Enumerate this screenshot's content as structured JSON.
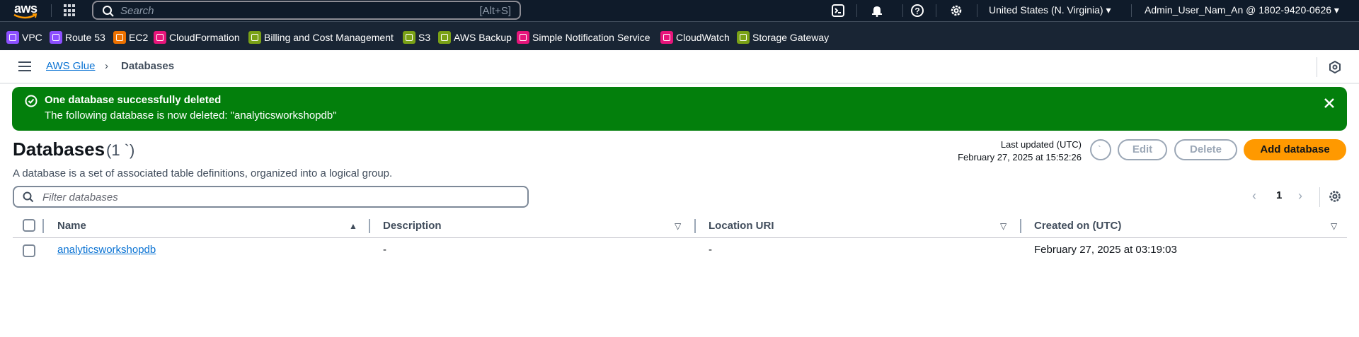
{
  "topnav": {
    "logo_text": "aws",
    "search_placeholder": "Search",
    "search_shortcut": "[Alt+S]",
    "region": "United States (N. Virginia)",
    "account": "Admin_User_Nam_An @ 1802-9420-0626"
  },
  "favorites": [
    {
      "label": "VPC",
      "color": "#8c4fff",
      "icon": "vpc-icon"
    },
    {
      "label": "Route 53",
      "color": "#8c4fff",
      "icon": "route53-icon"
    },
    {
      "label": "EC2",
      "color": "#ed7100",
      "icon": "ec2-icon"
    },
    {
      "label": "CloudFormation",
      "color": "#e7157b",
      "icon": "cloudformation-icon"
    },
    {
      "label": "Billing and Cost Management",
      "color": "#7aa116",
      "icon": "billing-icon"
    },
    {
      "label": "S3",
      "color": "#7aa116",
      "icon": "s3-icon"
    },
    {
      "label": "AWS Backup",
      "color": "#7aa116",
      "icon": "backup-icon"
    },
    {
      "label": "Simple Notification Service",
      "color": "#e7157b",
      "icon": "sns-icon"
    },
    {
      "label": "CloudWatch",
      "color": "#e7157b",
      "icon": "cloudwatch-icon"
    },
    {
      "label": "Storage Gateway",
      "color": "#7aa116",
      "icon": "storage-gateway-icon"
    }
  ],
  "breadcrumb": {
    "parent": "AWS Glue",
    "current": "Databases"
  },
  "flash": {
    "title": "One database successfully deleted",
    "body": "The following database is now deleted: \"analyticsworkshopdb\""
  },
  "header": {
    "title": "Databases",
    "count": "(1 `)",
    "description": "A database is a set of associated table definitions, organized into a logical group.",
    "last_updated_label": "Last updated (UTC)",
    "last_updated_value": "February 27, 2025 at 15:52:26",
    "edit_label": "Edit",
    "delete_label": "Delete",
    "add_label": "Add database"
  },
  "filter": {
    "placeholder": "Filter databases"
  },
  "pagination": {
    "current_page": "1"
  },
  "table": {
    "columns": [
      "Name",
      "Description",
      "Location URI",
      "Created on (UTC)"
    ],
    "rows": [
      {
        "name": "analyticsworkshopdb",
        "description": "-",
        "location": "-",
        "created": "February 27, 2025 at 03:19:03"
      }
    ]
  }
}
